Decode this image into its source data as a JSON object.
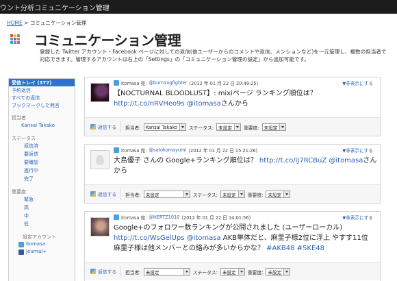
{
  "topbar": {
    "nav1": "ウント分析",
    "nav2": "コミュニケーション管理"
  },
  "breadcrumb": {
    "home": "HOME",
    "sep": ">",
    "current": "コミュニケーション管理"
  },
  "page": {
    "title": "コミュニケーション管理",
    "description": "登録した Twitter アカウント・Facebook ページに対しての返信(他ユーザーからのコメントや返信、メンションなど)を一元管理し、複数の担当者で対応できます。管理するアカウントは右上の「Settings」の「コミュニケーション管理の設定」から追加可能です。"
  },
  "sidebar": {
    "active": "受信トレイ (377)",
    "items": [
      "予約返信",
      "すべての返信",
      "ブックマークした発言"
    ],
    "assignee_head": "担当者",
    "assignee": "Kansai Takako",
    "status_head": "ステータス",
    "statuses": [
      "返信済",
      "要返信",
      "要確認",
      "進行中",
      "完了"
    ],
    "priority_head": "重要度",
    "priorities": [
      "緊急",
      "高",
      "中",
      "低"
    ],
    "account_head": "設定アカウント",
    "accounts": [
      "itomasa",
      "Journal+"
    ]
  },
  "labels": {
    "reply": "返信する",
    "hide": "▼非表示にする",
    "assignee": "担当者:",
    "status": "ステータス:",
    "priority": "重要度:"
  },
  "posts": [
    {
      "account": "itomasa 宛:",
      "handle": "@burn1ngfighter",
      "date": "(2012 年 01 月 22 日 20:49:25)",
      "text_a": "【NOCTURNAL BLOODLUST】: mixiページ ランキング順位は？ ",
      "link": "http://t.co/nRVHeo9s",
      "mention": "@itomasa",
      "text_b": "さんから",
      "assignee": "Kansai Takako",
      "status": "未設定",
      "priority": "未設定"
    },
    {
      "account": "itomasa 宛:",
      "handle": "@satokomayumi",
      "date": "(2012 年 01 月 22 日 15:21:26)",
      "text_a": "大島優子 さんの Google+ランキング順位は？ ",
      "link": "http://t.co/iJ7RCBuZ",
      "mention": "@itomasa",
      "text_b": "さんから",
      "assignee": "未設定",
      "status": "未設定",
      "priority": "未設定"
    },
    {
      "account": "itomasa 宛:",
      "handle": "@HERTZ1010",
      "date": "(2012 年 01 月 22 日 14:01:56)",
      "text_a": "Google+のフォロワー数ランキングが公開されました (ユーザーローカル) ",
      "link": "http://t.co/WsGelUps",
      "mention": "@itomasa",
      "text_b": "  AKB単体だと、麻里子様2位に浮上  やすす11位  麻里子様は他メンバーとの絡みが多いからかな？ ",
      "tag1": "#AKB48",
      "tag2": "#SKE48",
      "assignee": "未設定",
      "status": "未設定",
      "priority": "未設定"
    }
  ],
  "colors": {
    "accent": "#2e73c9",
    "link": "#2b62b3",
    "topbar": "#1c1c1c"
  }
}
